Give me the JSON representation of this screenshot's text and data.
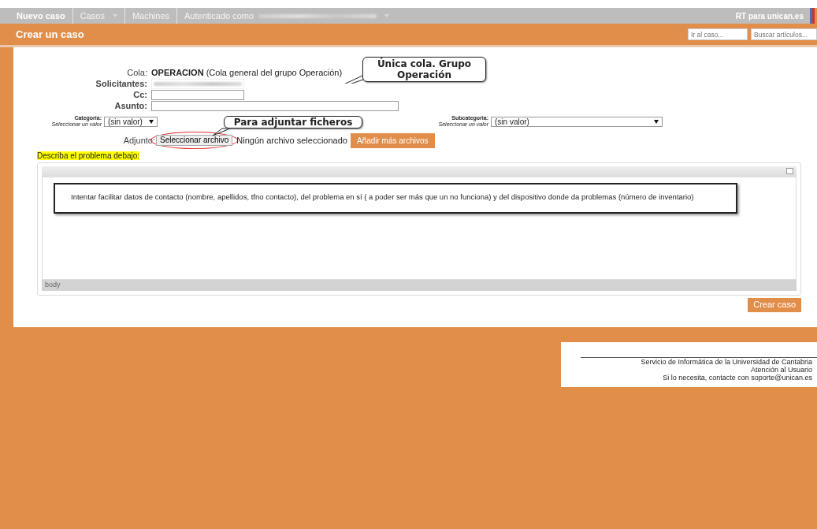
{
  "nav": {
    "items": [
      {
        "label": "Nuevo caso",
        "selected": true,
        "dropdown": false
      },
      {
        "label": "Casos",
        "selected": false,
        "dropdown": true
      },
      {
        "label": "Machines",
        "selected": false,
        "dropdown": false
      },
      {
        "label": "Autenticado como",
        "selected": false,
        "dropdown": true,
        "redacted": true
      }
    ],
    "brand": "RT para unican.es"
  },
  "header": {
    "title": "Crear un caso",
    "search_ticket": {
      "placeholder": "Ir al caso..."
    },
    "search_articles": {
      "placeholder": "Buscar artículos..."
    }
  },
  "form": {
    "queue": {
      "label": "Cola:",
      "value": "OPERACION",
      "description": "(Cola general del grupo Operación)"
    },
    "fields": [
      {
        "label": "Solicitantes:",
        "redacted": true
      },
      {
        "label": "Cc:",
        "redacted": false
      },
      {
        "label": "Asunto:",
        "redacted": false
      }
    ],
    "categoria": {
      "label": "Categoria:",
      "hint": "Seleccionar un valor",
      "value": "(sin valor)"
    },
    "subcategoria": {
      "label": "Subcategoria:",
      "hint": "Seleccionar un valor",
      "value": "(sin valor)"
    },
    "attachment": {
      "label": "Adjunto:",
      "button": "Seleccionar archivo",
      "status": "Ningún archivo seleccionado",
      "add_button": "Añadir más archivos"
    },
    "description_label": "Describa el problema debajo:",
    "editor": {
      "note": "Intentar facilitar datos de contacto (nombre, apellidos, tfno contacto), del problema en sí ( a poder ser más que un no funciona) y del dispositivo donde da problemas (número de inventario)",
      "status": "body"
    },
    "submit": "Crear caso"
  },
  "callouts": [
    {
      "text": "Única cola. Grupo Operación"
    },
    {
      "text": "Para adjuntar ficheros"
    }
  ],
  "footer": {
    "lines": [
      "Servicio de Informática de la Universidad de Cantabria",
      "Atención al Usuario",
      "Si lo necesita, contacte con soporte@unican.es"
    ]
  }
}
